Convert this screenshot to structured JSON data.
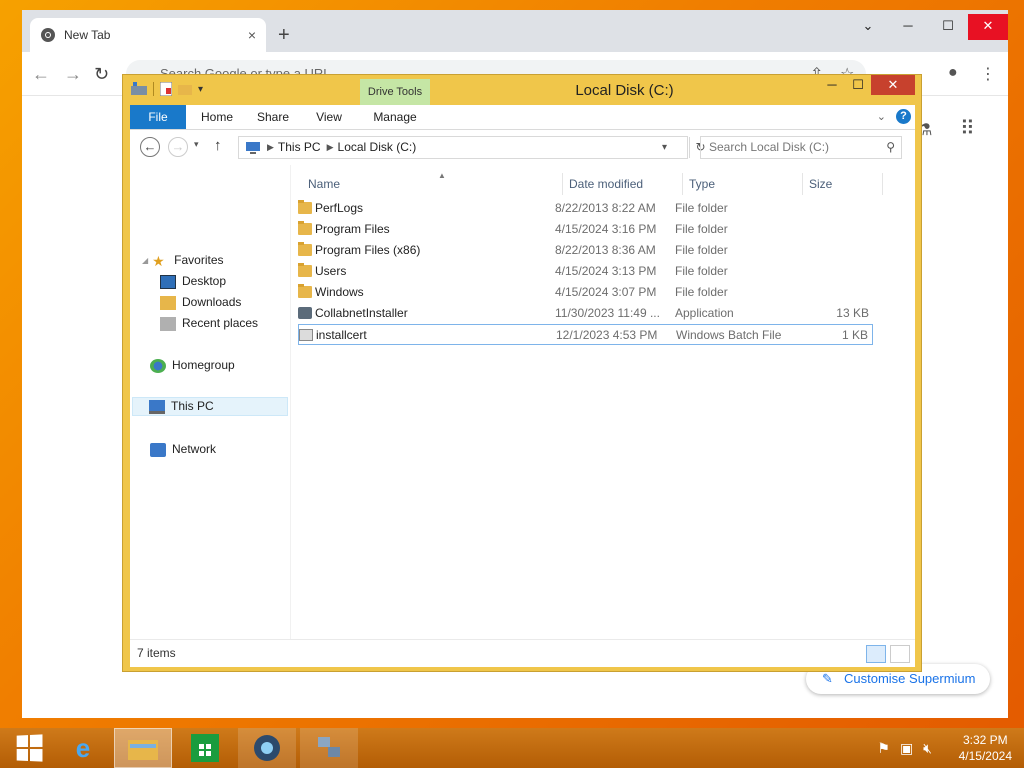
{
  "browser": {
    "tab_title": "New Tab",
    "tab_close": "×",
    "new_tab": "+",
    "omnibox_placeholder": "Search Google or type a URL",
    "customise_label": "Customise Supermium"
  },
  "explorer": {
    "title": "Local Disk (C:)",
    "contextual_tab": "Drive Tools",
    "ribbon_tabs": [
      "File",
      "Home",
      "Share",
      "View",
      "Manage"
    ],
    "breadcrumb": [
      "This PC",
      "Local Disk (C:)"
    ],
    "search_placeholder": "Search Local Disk (C:)",
    "nav": {
      "favorites": "Favorites",
      "desktop": "Desktop",
      "downloads": "Downloads",
      "recent": "Recent places",
      "homegroup": "Homegroup",
      "this_pc": "This PC",
      "network": "Network"
    },
    "columns": {
      "name": "Name",
      "date": "Date modified",
      "type": "Type",
      "size": "Size"
    },
    "files": [
      {
        "name": "PerfLogs",
        "date": "8/22/2013 8:22 AM",
        "type": "File folder",
        "size": "",
        "icon": "folder-icon"
      },
      {
        "name": "Program Files",
        "date": "4/15/2024 3:16 PM",
        "type": "File folder",
        "size": "",
        "icon": "folder-icon"
      },
      {
        "name": "Program Files (x86)",
        "date": "8/22/2013 8:36 AM",
        "type": "File folder",
        "size": "",
        "icon": "folder-icon"
      },
      {
        "name": "Users",
        "date": "4/15/2024 3:13 PM",
        "type": "File folder",
        "size": "",
        "icon": "folder-icon"
      },
      {
        "name": "Windows",
        "date": "4/15/2024 3:07 PM",
        "type": "File folder",
        "size": "",
        "icon": "folder-icon"
      },
      {
        "name": "CollabnetInstaller",
        "date": "11/30/2023 11:49 ...",
        "type": "Application",
        "size": "13 KB",
        "icon": "application-icon"
      },
      {
        "name": "installcert",
        "date": "12/1/2023 4:53 PM",
        "type": "Windows Batch File",
        "size": "1 KB",
        "icon": "batch-file-icon"
      }
    ],
    "status": "7 items"
  },
  "taskbar": {
    "time": "3:32 PM",
    "date": "4/15/2024"
  },
  "colors": {
    "explorer_frame": "#f0c64a",
    "file_tab": "#1979ca",
    "drive_tools": "#c5e6a5",
    "taskbar": "#c26a10",
    "close_button": "#c7412d"
  }
}
